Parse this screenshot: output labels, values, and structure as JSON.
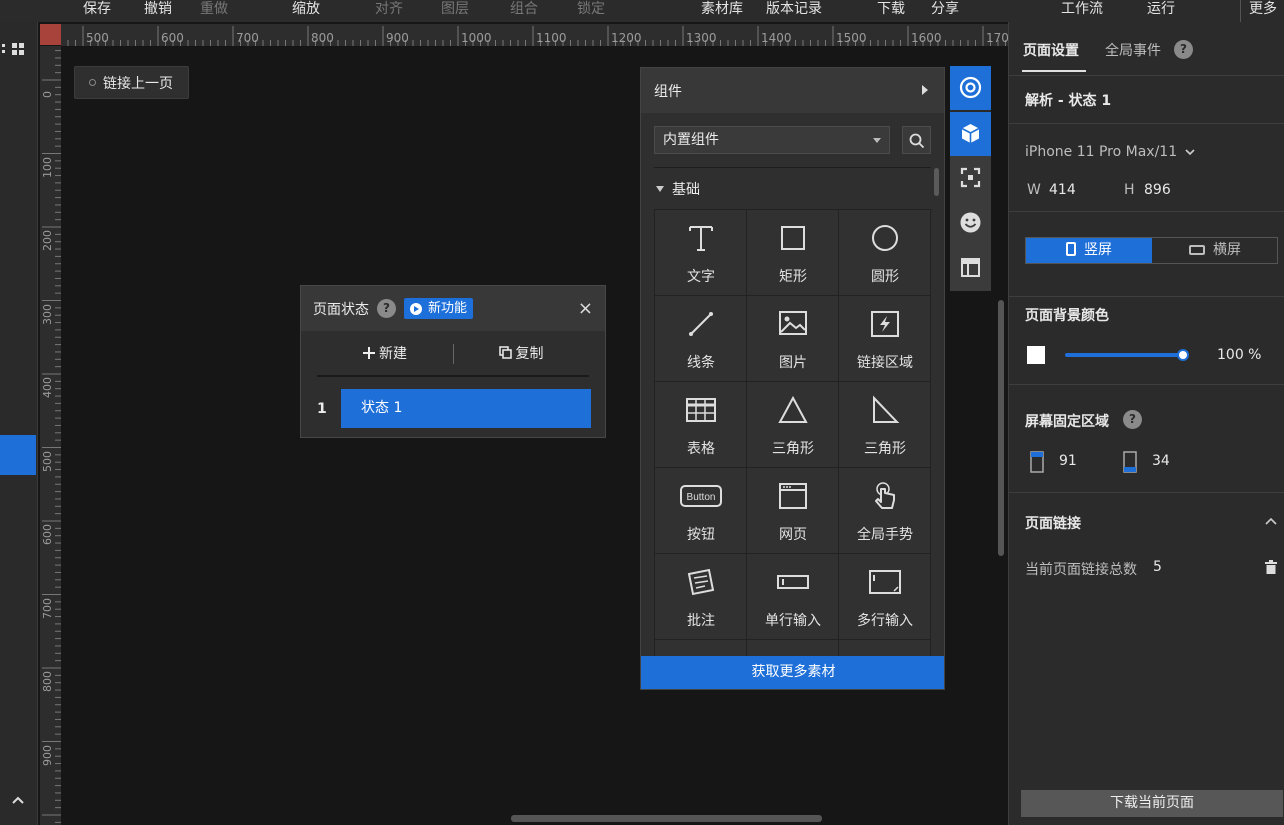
{
  "toolbar": {
    "save": "保存",
    "undo": "撤销",
    "redo": "重做",
    "zoom": "缩放",
    "align": "对齐",
    "layers": "图层",
    "group": "组合",
    "lock": "锁定",
    "assets": "素材库",
    "history": "版本记录",
    "download": "下载",
    "share": "分享",
    "workflow": "工作流",
    "run": "运行",
    "more": "更多"
  },
  "ruler": {
    "h_ticks": [
      "500",
      "600",
      "700",
      "800",
      "900",
      "1000",
      "1100",
      "1200",
      "1300",
      "1400",
      "1500",
      "1600",
      "170"
    ],
    "v_ticks": [
      "0",
      "100",
      "200",
      "300",
      "400",
      "500",
      "600",
      "700",
      "800",
      "900"
    ]
  },
  "canvas": {
    "link_prev": "链接上一页"
  },
  "page_state": {
    "title": "页面状态",
    "help": "?",
    "new_feature": "新功能",
    "close": "×",
    "new": "新建",
    "copy": "复制",
    "rows": [
      {
        "index": "1",
        "name": "状态 1"
      }
    ]
  },
  "components": {
    "title": "组件",
    "source": "内置组件",
    "group": "基础",
    "items": [
      "文字",
      "矩形",
      "圆形",
      "线条",
      "图片",
      "链接区域",
      "表格",
      "三角形",
      "三角形",
      "按钮",
      "网页",
      "全局手势",
      "批注",
      "单行输入",
      "多行输入"
    ],
    "button_icon_text": "Button",
    "more": "获取更多素材"
  },
  "right_panel": {
    "tab_page": "页面设置",
    "tab_global": "全局事件",
    "help": "?",
    "analysis": "解析 - 状态 1",
    "device": "iPhone 11 Pro Max/11",
    "w_label": "W",
    "w_value": "414",
    "h_label": "H",
    "h_value": "896",
    "portrait": "竖屏",
    "landscape": "横屏",
    "bg_title": "页面背景颜色",
    "bg_color": "#ffffff",
    "bg_opacity": "100 %",
    "fixed_title": "屏幕固定区域",
    "fixed_top": "91",
    "fixed_bottom": "34",
    "links_title": "页面链接",
    "links_count_label": "当前页面链接总数",
    "links_count": "5",
    "download_page": "下载当前页面"
  },
  "colors": {
    "accent": "#1e6fd8",
    "ruler_corner": "#a8433b"
  }
}
